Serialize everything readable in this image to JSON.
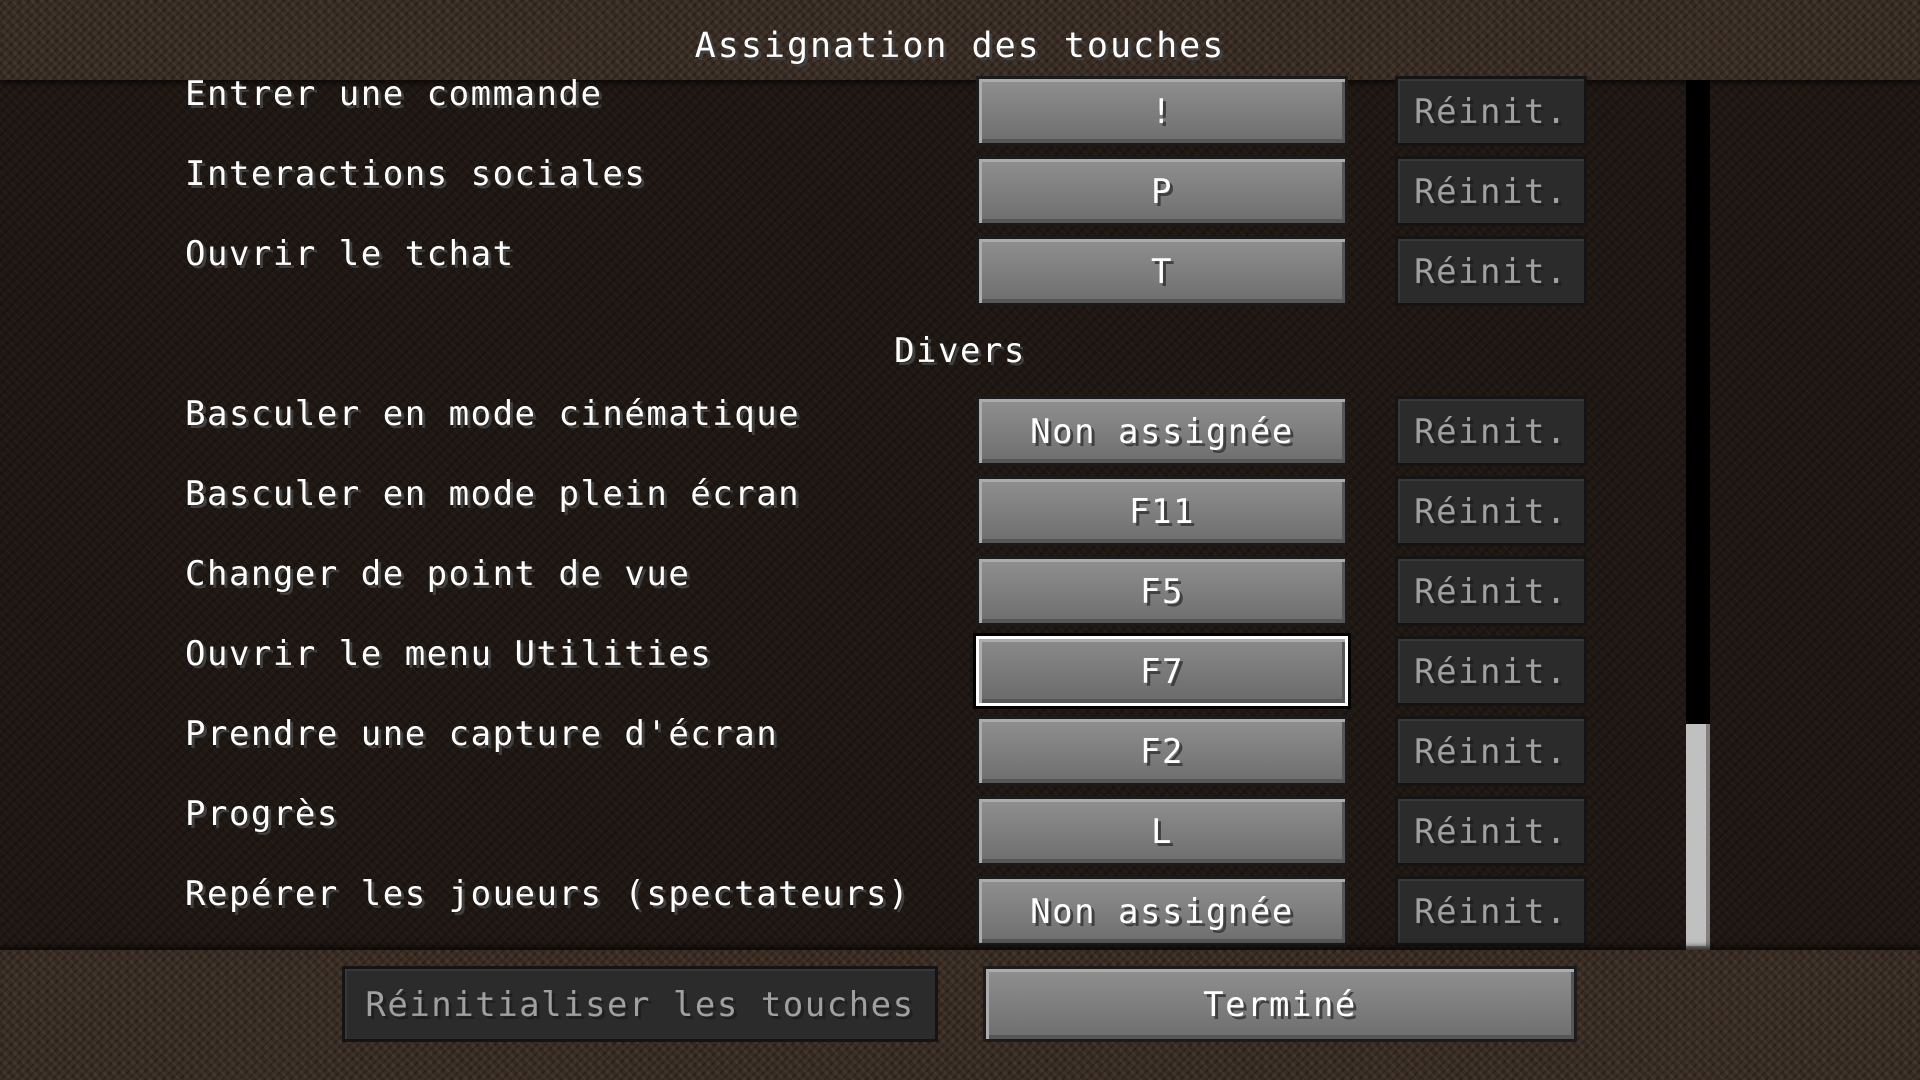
{
  "screen": {
    "title": "Assignation des touches"
  },
  "keybinds": {
    "top_rows": [
      {
        "label": "Entrer une commande",
        "key": "!",
        "reset": "Réinit."
      },
      {
        "label": "Interactions sociales",
        "key": "P",
        "reset": "Réinit."
      },
      {
        "label": "Ouvrir le tchat",
        "key": "T",
        "reset": "Réinit."
      }
    ],
    "category_misc": "Divers",
    "misc_rows": [
      {
        "label": "Basculer en mode cinématique",
        "key": "Non assignée",
        "reset": "Réinit."
      },
      {
        "label": "Basculer en mode plein écran",
        "key": "F11",
        "reset": "Réinit."
      },
      {
        "label": "Changer de point de vue",
        "key": "F5",
        "reset": "Réinit."
      },
      {
        "label": "Ouvrir le menu Utilities",
        "key": "F7",
        "reset": "Réinit.",
        "focused": true
      },
      {
        "label": "Prendre une capture d'écran",
        "key": "F2",
        "reset": "Réinit."
      },
      {
        "label": "Progrès",
        "key": "L",
        "reset": "Réinit."
      },
      {
        "label": "Repérer les joueurs (spectateurs)",
        "key": "Non assignée",
        "reset": "Réinit."
      }
    ]
  },
  "footer": {
    "reset_all_label": "Réinitialiser les touches",
    "done_label": "Terminé"
  }
}
